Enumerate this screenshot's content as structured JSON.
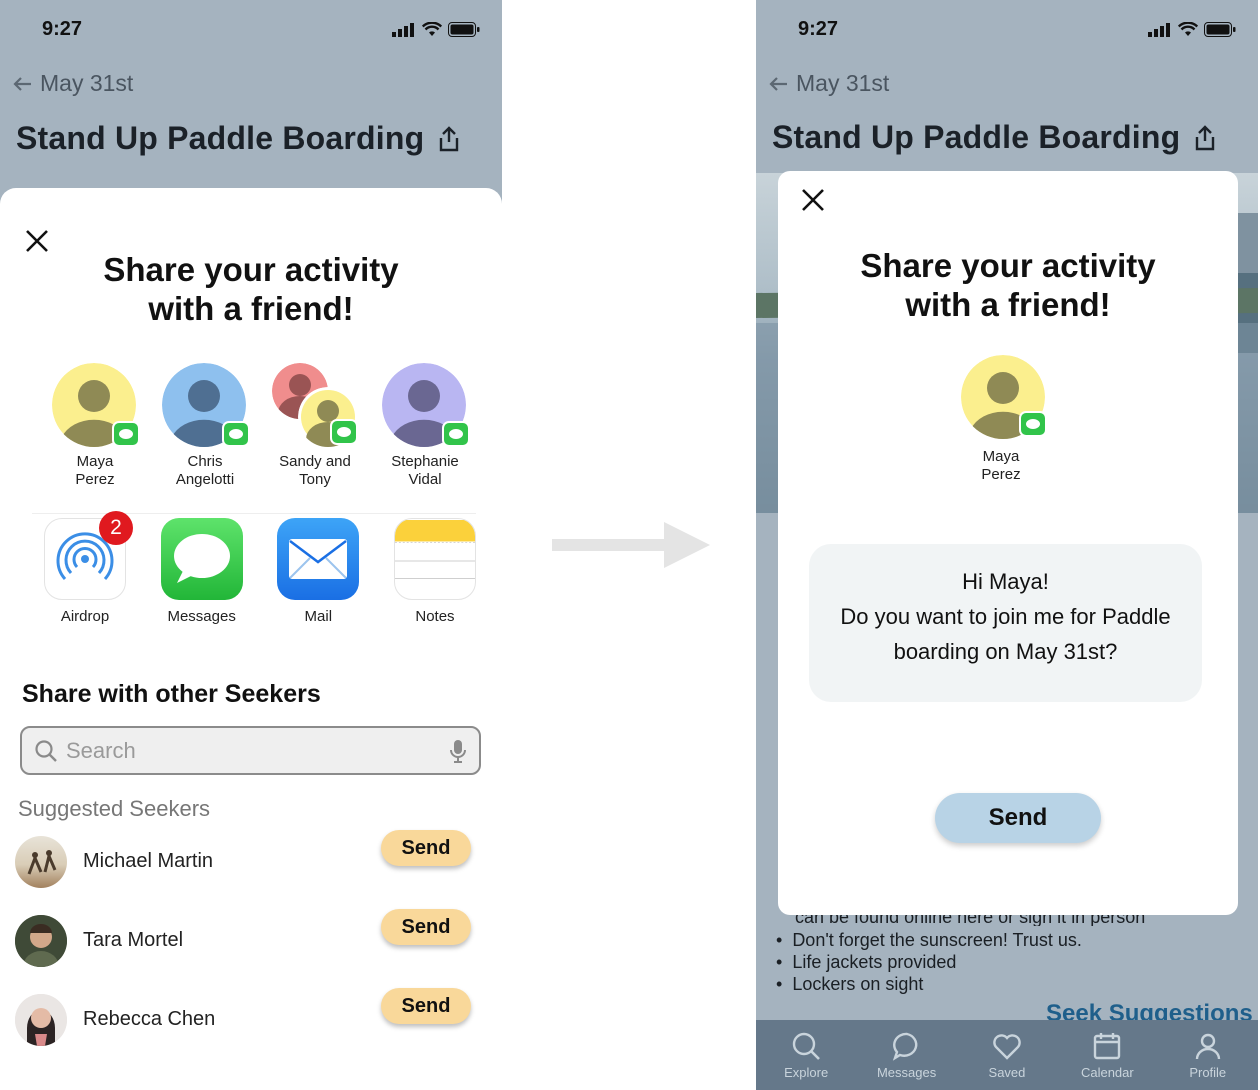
{
  "left": {
    "status": {
      "time": "9:27"
    },
    "header": {
      "back_label": "May 31st",
      "title": "Stand Up Paddle Boarding"
    },
    "share": {
      "heading_line1": "Share your activity",
      "heading_line2": "with a friend!",
      "friends": [
        {
          "name": "Maya\nPerez",
          "color": "#fbef8e"
        },
        {
          "name": "Chris\nAngelotti",
          "color": "#8ec0ee"
        },
        {
          "name": "Sandy and\nTony",
          "color": "#fbef8e"
        },
        {
          "name": "Stephanie\nVidal",
          "color": "#b9b6f2"
        }
      ],
      "apps": [
        {
          "label": "Airdrop",
          "badge": "2"
        },
        {
          "label": "Messages"
        },
        {
          "label": "Mail"
        },
        {
          "label": "Notes"
        }
      ],
      "other_heading": "Share with other Seekers",
      "search_placeholder": "Search",
      "suggested_heading": "Suggested Seekers",
      "seekers": [
        {
          "name": "Michael Martin",
          "send": "Send"
        },
        {
          "name": "Tara Mortel",
          "send": "Send"
        },
        {
          "name": "Rebecca Chen",
          "send": "Send"
        }
      ]
    }
  },
  "right": {
    "status": {
      "time": "9:27"
    },
    "header": {
      "back_label": "May 31st",
      "title": "Stand Up Paddle Boarding"
    },
    "modal": {
      "heading_line1": "Share your activity",
      "heading_line2": "with a friend!",
      "recipient": "Maya\nPerez",
      "message_line1": "Hi Maya!",
      "message_line2": "Do you want to join me for Paddle",
      "message_line3": "boarding on May 31st?",
      "send": "Send"
    },
    "background": {
      "partial_line": "can be found online here or sign it in person",
      "bullets": [
        "Don't forget the sunscreen! Trust us.",
        "Life jackets provided",
        "Lockers on sight"
      ],
      "seek_suggestions": "Seek Suggestions"
    },
    "tabs": [
      "Explore",
      "Messages",
      "Saved",
      "Calendar",
      "Profile"
    ]
  },
  "colors": {
    "send_yellow": "#f9d89a",
    "send_blue": "#b8d3e6",
    "messages_green": "#31c44a",
    "badge_red": "#e0191f"
  }
}
